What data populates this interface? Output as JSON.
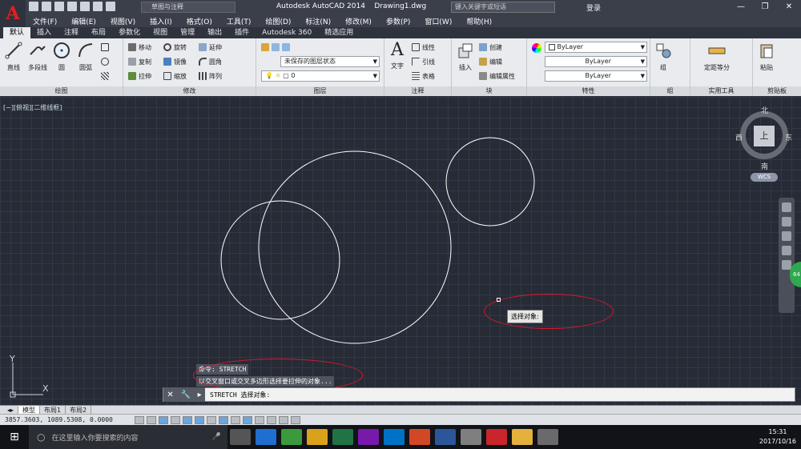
{
  "title_bar": {
    "workspace": "草图与注释",
    "app_title": "Autodesk AutoCAD 2014    Drawing1.dwg",
    "search_placeholder": "键入关键字或短语",
    "login": "登录"
  },
  "menu": [
    "文件(F)",
    "编辑(E)",
    "视图(V)",
    "插入(I)",
    "格式(O)",
    "工具(T)",
    "绘图(D)",
    "标注(N)",
    "修改(M)",
    "参数(P)",
    "窗口(W)",
    "帮助(H)"
  ],
  "ribbon_tabs": [
    "默认",
    "插入",
    "注释",
    "布局",
    "参数化",
    "视图",
    "管理",
    "输出",
    "插件",
    "Autodesk 360",
    "精选应用"
  ],
  "panels": {
    "draw": {
      "title": "绘图",
      "big": [
        "直线",
        "多段线",
        "圆",
        "圆弧"
      ]
    },
    "modify": {
      "title": "修改",
      "items": [
        "移动",
        "旋转",
        "延伸",
        "复制",
        "镜像",
        "圆角",
        "拉伸",
        "缩放",
        "阵列"
      ]
    },
    "layers": {
      "title": "图层",
      "state": "未保存的图层状态",
      "current": "0"
    },
    "annotation": {
      "title": "注释",
      "big": "文字",
      "items": [
        "线性",
        "引线",
        "表格"
      ]
    },
    "block": {
      "title": "块",
      "big": "插入",
      "items": [
        "创建",
        "编辑",
        "编辑属性"
      ]
    },
    "properties": {
      "title": "特性",
      "values": [
        "ByLayer",
        "ByLayer",
        "ByLayer"
      ]
    },
    "groups": {
      "title": "组",
      "big": "组"
    },
    "utilities": {
      "title": "实用工具",
      "big": "定距等分"
    },
    "clipboard": {
      "title": "剪贴板",
      "big": "粘贴"
    }
  },
  "canvas": {
    "view_label": "[−][俯视][二维线框]",
    "viewcube": {
      "n": "北",
      "s": "南",
      "e": "东",
      "w": "西",
      "top": "上"
    },
    "wcs": "WCS",
    "tooltip": "选择对象:",
    "ucs_x": "X",
    "ucs_y": "Y",
    "nav_badge": "64"
  },
  "command": {
    "history": [
      "命令: STRETCH",
      "以交叉窗口或交叉多边形选择要拉伸的对象..."
    ],
    "prompt": "STRETCH 选择对象:"
  },
  "layout_tabs": [
    "模型",
    "布局1",
    "布局2"
  ],
  "status": {
    "coords": "3857.3603, 1089.5308, 0.0000"
  },
  "taskbar": {
    "search_placeholder": "在这里输入你要搜索的内容",
    "time": "15:31",
    "date": "2017/10/16"
  },
  "colors": {
    "canvas_bg": "#262b36",
    "entity": "#ffffff",
    "highlight_ring": "#d8182a",
    "title_bar": "#3a3f4a"
  }
}
